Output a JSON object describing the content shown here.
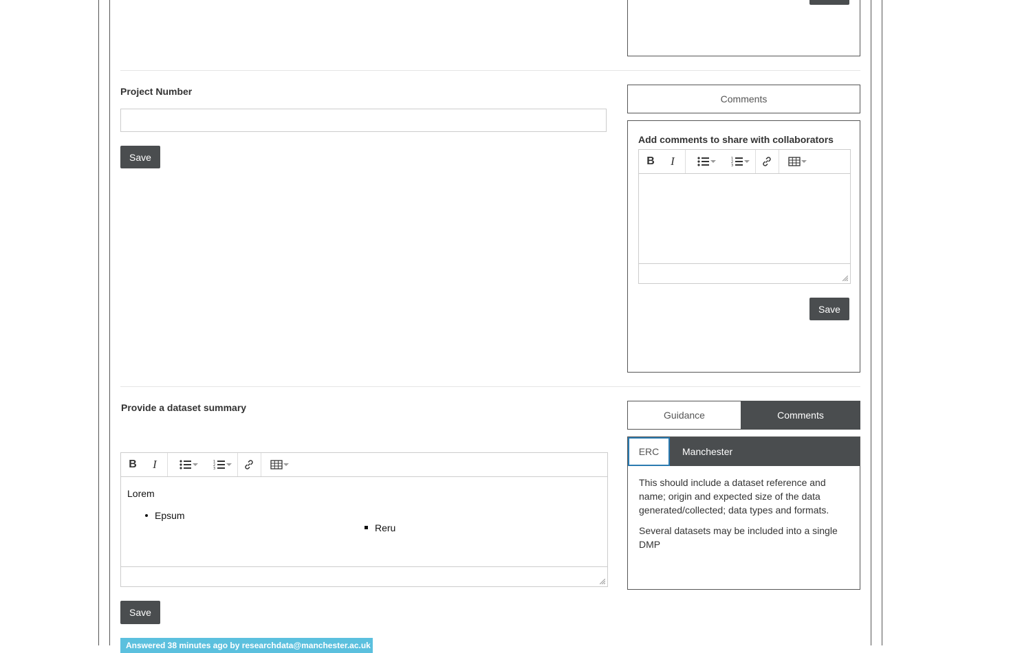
{
  "question1": {
    "label": "Project Number",
    "input_value": "",
    "save_label": "Save",
    "side_tab": "Comments",
    "comments_heading": "Add comments to share with collaborators",
    "comments_save_label": "Save"
  },
  "question2": {
    "label": "Provide a dataset summary",
    "editor": {
      "paragraph": "Lorem",
      "bullet": "Epsum",
      "nested_bullet": "Reru"
    },
    "save_label": "Save",
    "answered_text": "Answered 38 minutes ago by researchdata@manchester.ac.uk",
    "tabs": [
      "Guidance",
      "Comments"
    ],
    "active_tab": "Comments",
    "subtabs": [
      "ERC",
      "Manchester"
    ],
    "active_subtab": "ERC",
    "guidance_paragraphs": [
      "This should include a dataset reference and name; origin and expected size of the data generated/collected; data types and formats.",
      "Several datasets may be included into a single DMP"
    ]
  },
  "colors": {
    "dark_button": "#4a4d4f",
    "answered_badge": "#5bc0de",
    "subtab_active_border": "#2a7ab0"
  },
  "icons": [
    "bold-icon",
    "italic-icon",
    "bullet-list-icon",
    "numbered-list-icon",
    "link-icon",
    "table-icon",
    "resize-handle-icon"
  ]
}
